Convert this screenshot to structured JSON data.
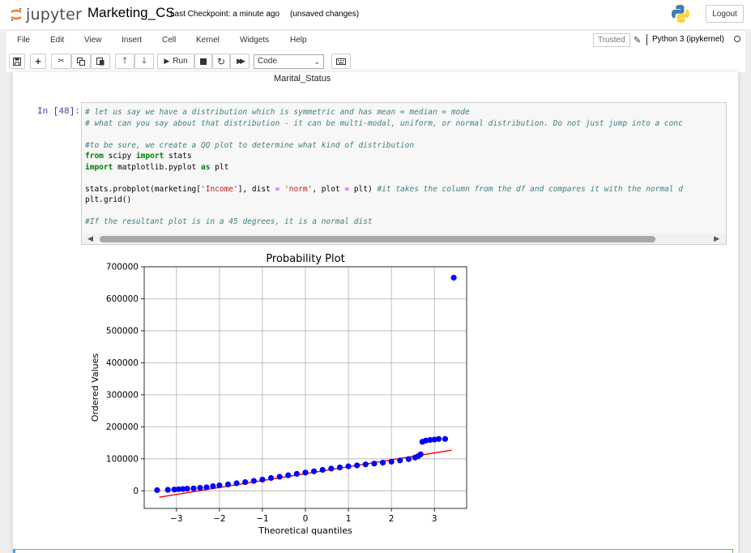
{
  "header": {
    "logo_text": "jupyter",
    "notebook_name": "Marketing_CS",
    "checkpoint": "Last Checkpoint: a minute ago",
    "save_status": "(unsaved changes)",
    "logout_label": "Logout",
    "python_logo_icon": "python-logo-icon"
  },
  "menu": {
    "items": [
      "File",
      "Edit",
      "View",
      "Insert",
      "Cell",
      "Kernel",
      "Widgets",
      "Help"
    ],
    "trusted_label": "Trusted",
    "kernel_name": "Python 3 (ipykernel)"
  },
  "toolbar": {
    "run_label": "Run",
    "cell_type": "Code",
    "icons": [
      "save-icon",
      "plus-icon",
      "cut-icon",
      "copy-icon",
      "paste-icon",
      "arrow-up-icon",
      "arrow-down-icon",
      "run-icon",
      "stop-icon",
      "restart-icon",
      "fast-forward-icon",
      "keyboard-icon"
    ]
  },
  "notebook": {
    "previous_output_label": "Marital_Status",
    "cell": {
      "prompt": "In [48]:",
      "code_lines": [
        [
          [
            "cmt",
            "# let us say we have a distribution which is symmetric and has mean = median = mode"
          ]
        ],
        [
          [
            "cmt",
            "# what can you say about that distribution - it can be multi-modal, uniform, or normal distribution. Do not just jump into a conc"
          ]
        ],
        [],
        [
          [
            "cmt",
            "#to be sure, we create a QQ plot to determine what kind of distribution"
          ]
        ],
        [
          [
            "kw",
            "from"
          ],
          [
            "",
            " scipy "
          ],
          [
            "kw",
            "import"
          ],
          [
            "",
            " stats"
          ]
        ],
        [
          [
            "kw",
            "import"
          ],
          [
            "",
            " matplotlib.pyplot "
          ],
          [
            "kw",
            "as"
          ],
          [
            "",
            " plt"
          ]
        ],
        [],
        [
          [
            "",
            "stats.probplot(marketing["
          ],
          [
            "str",
            "'Income'"
          ],
          [
            "",
            "], dist "
          ],
          [
            "op",
            "="
          ],
          [
            "",
            " "
          ],
          [
            "str",
            "'norm'"
          ],
          [
            "",
            ", plot "
          ],
          [
            "op",
            "="
          ],
          [
            "",
            " plt) "
          ],
          [
            "cmt",
            "#it takes the column from the df and compares it with the normal d"
          ]
        ],
        [
          [
            "",
            "plt.grid()"
          ]
        ],
        [],
        [
          [
            "cmt",
            "#If the resultant plot is in a 45 degrees, it is a normal dist"
          ]
        ]
      ]
    }
  },
  "chart_data": {
    "type": "scatter",
    "title": "Probability Plot",
    "xlabel": "Theoretical quantiles",
    "ylabel": "Ordered Values",
    "xlim": [
      -3.75,
      3.75
    ],
    "ylim": [
      -55000,
      700000
    ],
    "xticks": [
      -3,
      -2,
      -1,
      0,
      1,
      2,
      3
    ],
    "xtick_labels": [
      "−3",
      "−2",
      "−1",
      "0",
      "1",
      "2",
      "3"
    ],
    "yticks": [
      0,
      100000,
      200000,
      300000,
      400000,
      500000,
      600000,
      700000
    ],
    "ytick_labels": [
      "0",
      "100000",
      "200000",
      "300000",
      "400000",
      "500000",
      "600000",
      "700000"
    ],
    "grid": true,
    "point_color": "#0000ff",
    "line_color": "#ff0000",
    "fit_line": {
      "x": [
        -3.4,
        3.4
      ],
      "y": [
        -20000,
        127000
      ]
    },
    "points": [
      [
        -3.45,
        2000
      ],
      [
        -3.2,
        3000
      ],
      [
        -3.05,
        4000
      ],
      [
        -2.95,
        5000
      ],
      [
        -2.85,
        5500
      ],
      [
        -2.75,
        6500
      ],
      [
        -2.6,
        7500
      ],
      [
        -2.45,
        9500
      ],
      [
        -2.3,
        11000
      ],
      [
        -2.15,
        14500
      ],
      [
        -2.0,
        17000
      ],
      [
        -1.8,
        20000
      ],
      [
        -1.6,
        23500
      ],
      [
        -1.4,
        27000
      ],
      [
        -1.2,
        31000
      ],
      [
        -1.0,
        35000
      ],
      [
        -0.8,
        40000
      ],
      [
        -0.6,
        44000
      ],
      [
        -0.4,
        48500
      ],
      [
        -0.2,
        53000
      ],
      [
        0.0,
        57000
      ],
      [
        0.2,
        61000
      ],
      [
        0.4,
        65500
      ],
      [
        0.6,
        69500
      ],
      [
        0.8,
        73000
      ],
      [
        1.0,
        76500
      ],
      [
        1.2,
        79500
      ],
      [
        1.4,
        82500
      ],
      [
        1.6,
        85000
      ],
      [
        1.8,
        88000
      ],
      [
        2.0,
        91000
      ],
      [
        2.2,
        95000
      ],
      [
        2.4,
        99000
      ],
      [
        2.55,
        104000
      ],
      [
        2.62,
        108000
      ],
      [
        2.68,
        114000
      ],
      [
        2.72,
        153000
      ],
      [
        2.8,
        157000
      ],
      [
        2.9,
        159000
      ],
      [
        3.0,
        160000
      ],
      [
        3.1,
        162000
      ],
      [
        3.25,
        162000
      ],
      [
        3.45,
        666000
      ]
    ]
  }
}
